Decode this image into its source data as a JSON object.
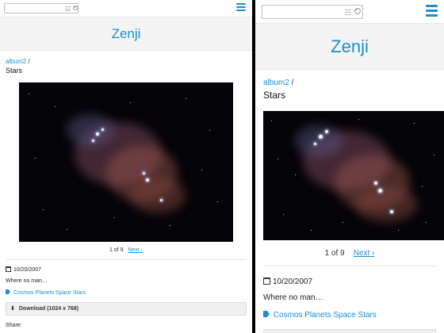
{
  "app": {
    "brand": "Zenji"
  },
  "search": {
    "placeholder": ""
  },
  "breadcrumb": {
    "album": "album2",
    "separator": "/"
  },
  "photo": {
    "title": "Stars",
    "alt": "Stars nebula photo"
  },
  "pager": {
    "position": "1 of 9",
    "next_label": "Next",
    "next_icon": "chevron-right-icon"
  },
  "details": {
    "date": "10/20/2007",
    "description": "Where no man…",
    "tags": [
      "Cosmos",
      "Planets",
      "Space",
      "Stars"
    ],
    "download_label": "Download (1024 x 768)",
    "share_label": "Share:"
  },
  "colors": {
    "accent": "#1a8fd1",
    "header_bg": "#f4f4f4",
    "share_blue": "#3b5998",
    "share_light": "#55acee",
    "share_dark": "#111111"
  }
}
